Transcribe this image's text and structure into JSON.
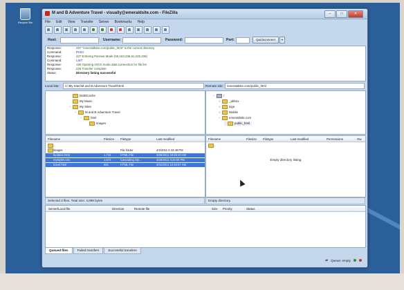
{
  "desktop": {
    "recycle_bin_label": "Recycle Bin"
  },
  "window": {
    "title": "M and B Adventure Travel - visually@emeraldsite.com - FileZilla",
    "buttons": {
      "minimize": "–",
      "maximize": "□",
      "close": "✕"
    }
  },
  "menu": [
    "File",
    "Edit",
    "View",
    "Transfer",
    "Server",
    "Bookmarks",
    "Help"
  ],
  "quickconnect": {
    "host_label": "Host:",
    "username_label": "Username:",
    "password_label": "Password:",
    "port_label": "Port:",
    "connect_label": "Quickconnect",
    "dropdown_label": "▾"
  },
  "log": [
    {
      "key": "Response:",
      "value": "257 \"/emeraldsite.com/public_html\" is the current directory",
      "tone": "green"
    },
    {
      "key": "Command:",
      "value": "PASV",
      "tone": "blue"
    },
    {
      "key": "Response:",
      "value": "227 Entering Passive Mode (69,163,236,61,225,236)",
      "tone": "green"
    },
    {
      "key": "Command:",
      "value": "LIST",
      "tone": "blue"
    },
    {
      "key": "Response:",
      "value": "150 Opening ASCII mode data connection for file list",
      "tone": "green"
    },
    {
      "key": "Response:",
      "value": "226 Transfer complete",
      "tone": "green"
    },
    {
      "key": "Status:",
      "value": "Directory listing successful",
      "tone": "dark"
    }
  ],
  "local": {
    "site_label": "Local site:",
    "path": "C:\\My Sites\\M and B Adventure Travel\\html\\",
    "tree": [
      {
        "label": "bit3DCache",
        "indent": 2,
        "expander": ""
      },
      {
        "label": "My Music",
        "indent": 2,
        "expander": ""
      },
      {
        "label": "My Sites",
        "indent": 2,
        "expander": "−"
      },
      {
        "label": "M and B Adventure Travel",
        "indent": 3,
        "expander": "−"
      },
      {
        "label": "html",
        "indent": 4,
        "expander": "−"
      },
      {
        "label": "images",
        "indent": 5,
        "expander": ""
      }
    ],
    "columns": [
      "Filename",
      "Filesize",
      "Filetype",
      "Last modified"
    ],
    "files": [
      {
        "name": "..",
        "size": "",
        "type": "",
        "modified": "",
        "selected": false
      },
      {
        "name": "images",
        "size": "",
        "type": "File folder",
        "modified": "4/2/2011 2:43:48 PM",
        "selected": false
      },
      {
        "name": "facilities.html",
        "size": "1,724",
        "type": "HTML File",
        "modified": "3/30/2011 10:45:40 AM",
        "selected": true
      },
      {
        "name": "mystyles.css",
        "size": "1,574",
        "type": "Cascading Sty...",
        "modified": "3/30/2011 4:22:05 PM",
        "selected": true
      },
      {
        "name": "travel.html",
        "size": "951",
        "type": "HTML File",
        "modified": "3/31/2011 10:40:57 AM",
        "selected": true
      }
    ],
    "status": "Selected 3 files. Total size: 4,099 bytes"
  },
  "remote": {
    "site_label": "Remote site:",
    "path": "/emeraldsite.com/public_html",
    "tree": [
      {
        "label": "/",
        "indent": 0,
        "expander": "−"
      },
      {
        "label": "_pbbox",
        "indent": 1,
        "expander": "+"
      },
      {
        "label": "logs",
        "indent": 1,
        "expander": "+"
      },
      {
        "label": "Mobile",
        "indent": 1,
        "expander": "+"
      },
      {
        "label": "emeraldsite.com",
        "indent": 1,
        "expander": "−"
      },
      {
        "label": "public_html",
        "indent": 2,
        "expander": ""
      }
    ],
    "columns": [
      "Filename",
      "Filesize",
      "Filetype",
      "Last modified",
      "Permissions",
      "Ow"
    ],
    "files": [
      {
        "name": ".."
      }
    ],
    "empty_message": "Empty directory listing",
    "status": "Empty directory."
  },
  "queue": {
    "columns": [
      "Server/Local file",
      "Direction",
      "Remote file",
      "Size",
      "Priority",
      "Status"
    ],
    "tabs": [
      "Queued files",
      "Failed transfers",
      "Successful transfers"
    ],
    "status": "Queue: empty"
  }
}
